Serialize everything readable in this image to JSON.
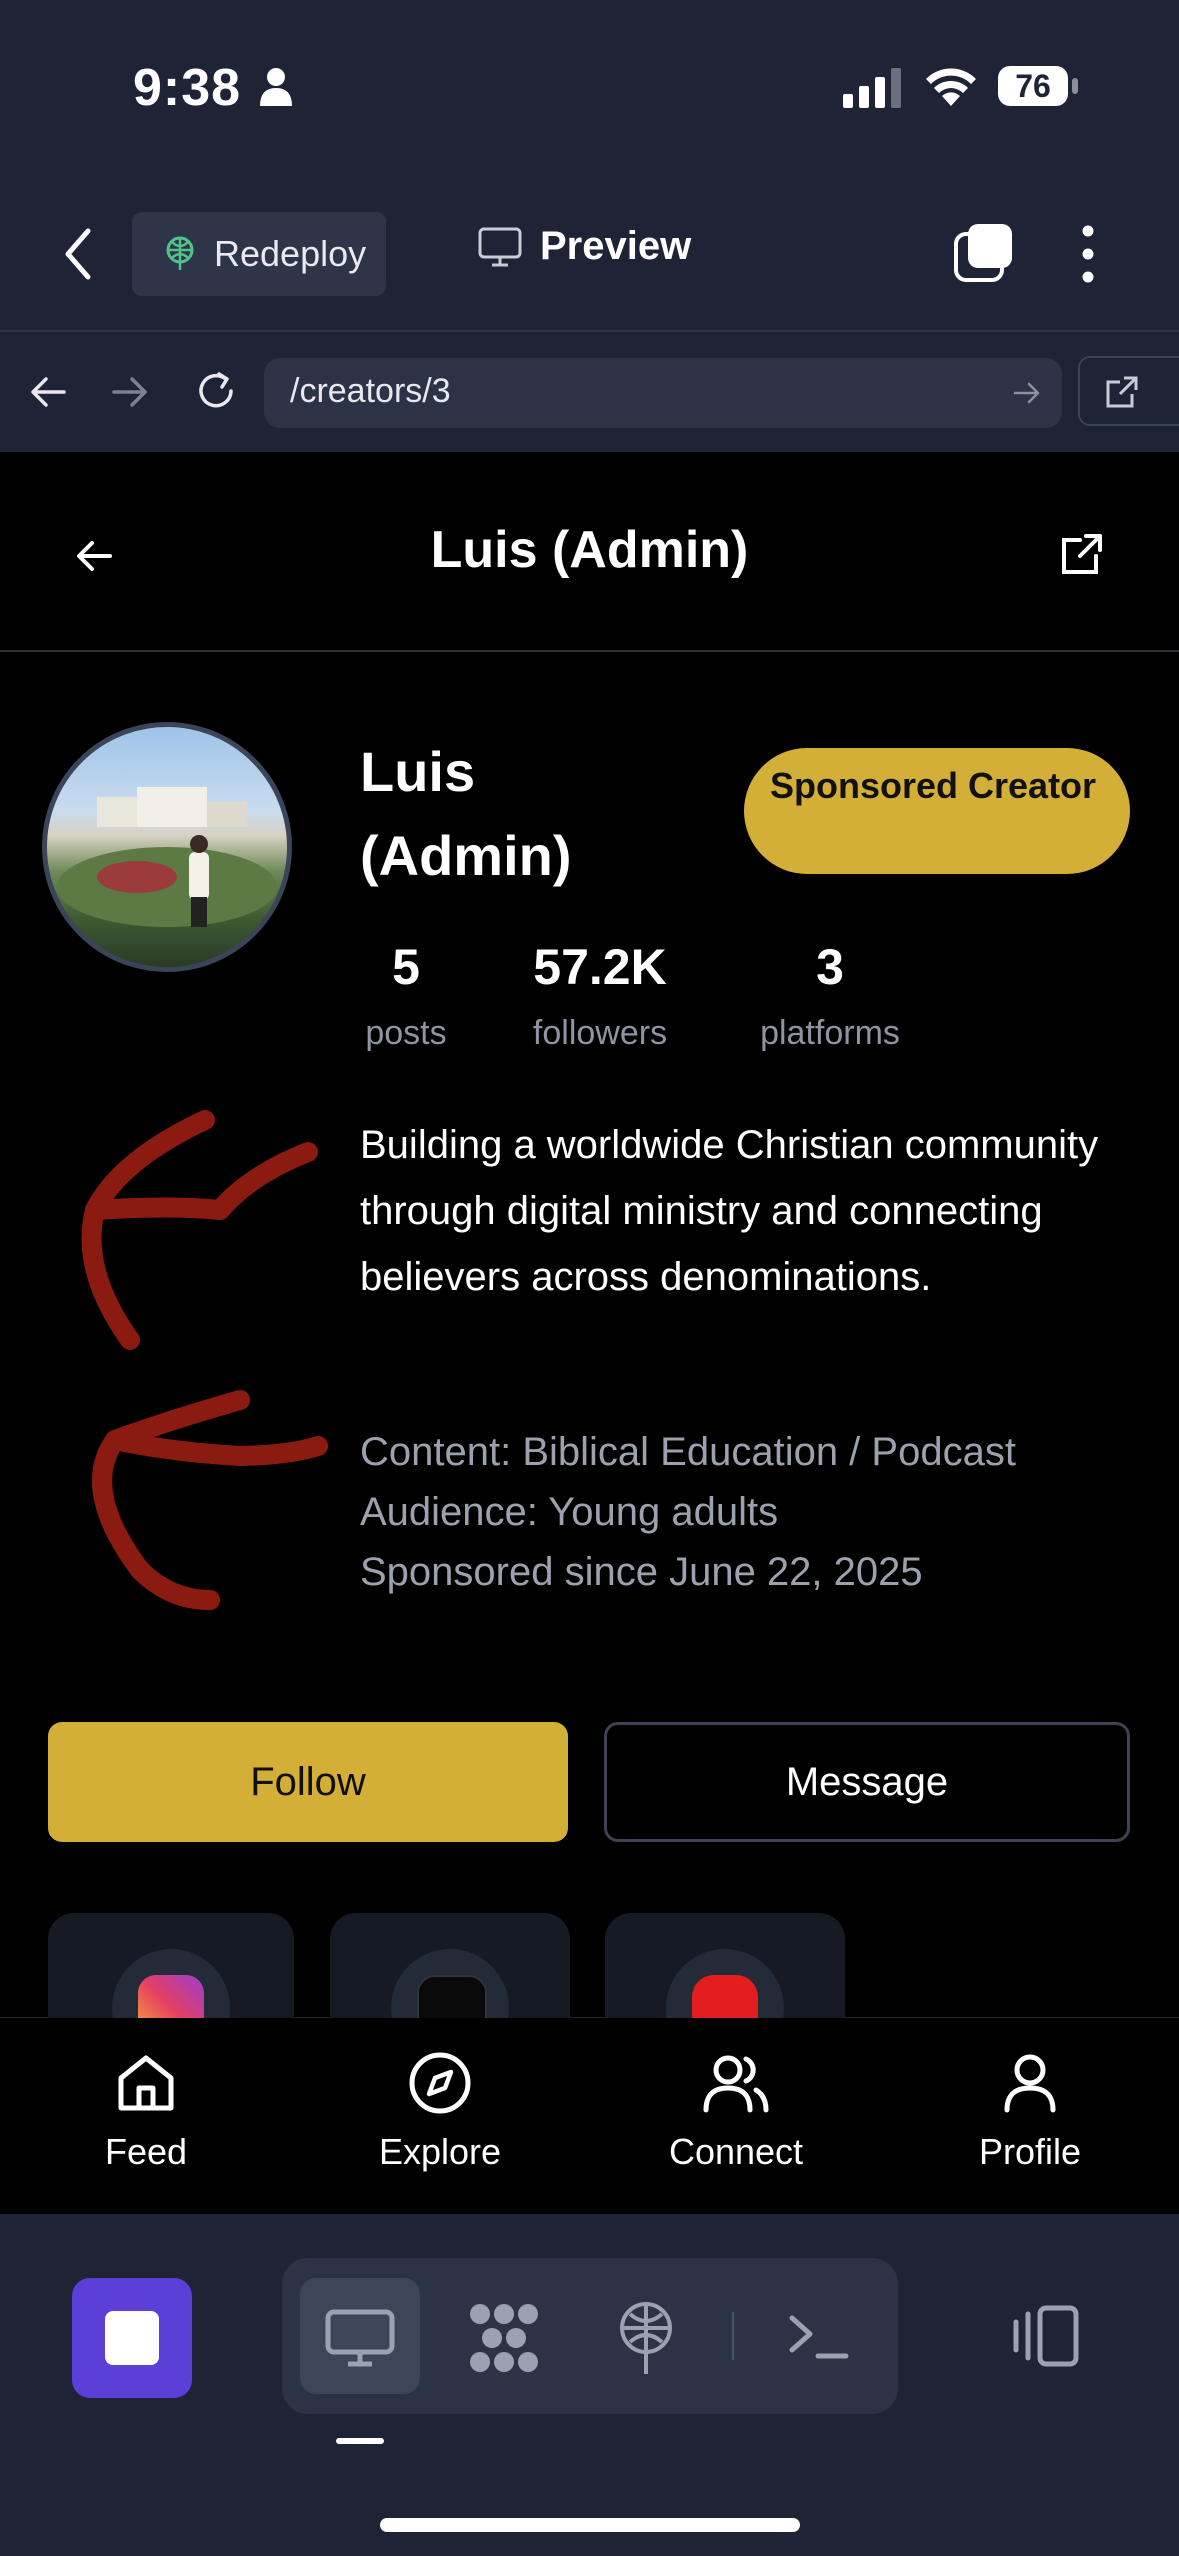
{
  "status_bar": {
    "time": "9:38",
    "battery": "76"
  },
  "toolbar": {
    "redeploy_label": "Redeploy",
    "preview_label": "Preview"
  },
  "url_bar": {
    "url": "/creators/3"
  },
  "header": {
    "title": "Luis (Admin)"
  },
  "profile": {
    "name": "Luis (Admin)",
    "badge": "Sponsored Creator",
    "stats": [
      {
        "value": "5",
        "label": "posts"
      },
      {
        "value": "57.2K",
        "label": "followers"
      },
      {
        "value": "3",
        "label": "platforms"
      }
    ],
    "bio": "Building a worldwide Christian community through digital ministry and connecting believers across denominations.",
    "meta": {
      "content": "Content: Biblical Education / Podcast",
      "audience": "Audience: Young adults",
      "sponsored": "Sponsored since June 22, 2025"
    },
    "actions": {
      "follow": "Follow",
      "message": "Message"
    },
    "platforms": [
      "instagram-icon",
      "tiktok-icon",
      "youtube-icon"
    ]
  },
  "tabbar": {
    "items": [
      {
        "label": "Feed",
        "icon": "home-icon"
      },
      {
        "label": "Explore",
        "icon": "compass-icon"
      },
      {
        "label": "Connect",
        "icon": "users-icon"
      },
      {
        "label": "Profile",
        "icon": "user-icon"
      }
    ]
  },
  "colors": {
    "accent": "#d4af37",
    "background": "#000000",
    "chrome": "#1e2436",
    "stop_button": "#5b3fd6",
    "annotation": "#8b1a10"
  }
}
